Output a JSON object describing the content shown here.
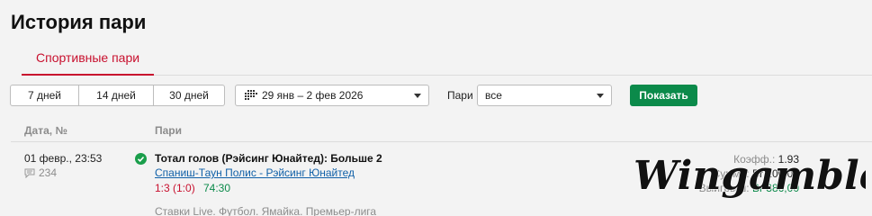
{
  "page": {
    "title": "История пари"
  },
  "tabs": [
    {
      "label": "Спортивные пари"
    }
  ],
  "filters": {
    "periods": [
      "7 дней",
      "14 дней",
      "30 дней"
    ],
    "date_range": "29 янв – 2 фев 2026",
    "bets_label": "Пари",
    "bets_value": "все",
    "show_label": "Показать"
  },
  "table": {
    "headers": {
      "date": "Дата, №",
      "bets": "Пари"
    },
    "rows": [
      {
        "date": "01 февр., 23:53",
        "number": "234",
        "title": "Тотал голов (Рэйсинг Юнайтед): Больше 2",
        "match": "Спаниш-Таун Полис - Рэйсинг Юнайтед",
        "score": "1:3 (1:0)",
        "time": "74:30",
        "category": "Ставки Live. Футбол. Ямайка. Премьер-лига",
        "coeff_label": "Коэфф.:",
        "coeff_value": "1.93",
        "stake_label": "Сумма:",
        "stake_value": "Br 200,00",
        "win_label": "Выигрыш:",
        "win_value": "Br 386,00"
      }
    ]
  },
  "watermark": {
    "text": "Wingamble"
  },
  "colors": {
    "accent": "#c8102e",
    "green": "#0b8a4a",
    "link": "#1060a8"
  }
}
